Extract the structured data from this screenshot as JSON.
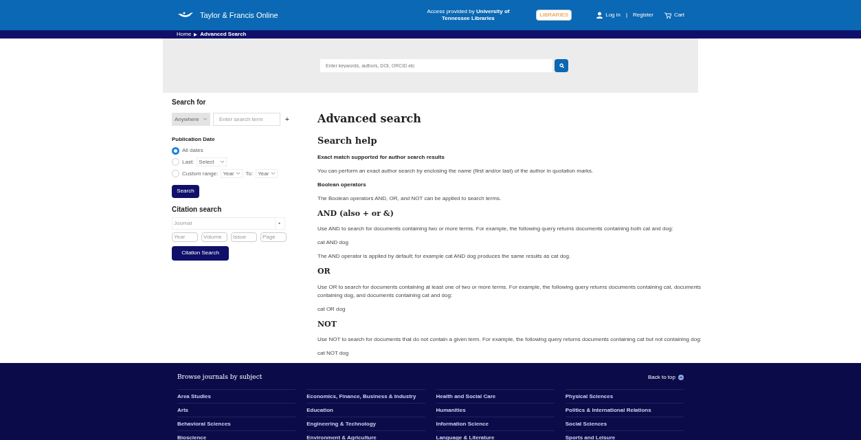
{
  "header": {
    "brand": "Taylor & Francis Online",
    "access": "Access provided by **University of Tennessee Libraries**",
    "library_badge": "LIBRARIES",
    "login": "Log in",
    "separator": "|",
    "register": "Register",
    "cart": "Cart"
  },
  "breadcrumb": [
    {
      "label": "Home"
    },
    {
      "label": "Advanced Search"
    }
  ],
  "quick_search": {
    "placeholder": "Enter keywords, authors, DOI, ORCID etc"
  },
  "search_for": {
    "title": "Search for",
    "scope": "Anywhere",
    "placeholder": "Enter search term",
    "add": "+"
  },
  "publication_date": {
    "title": "Publication Date",
    "options": [
      {
        "kind": "plain",
        "label": "All dates",
        "selected": true
      },
      {
        "kind": "last",
        "label": "Last:",
        "select": "Select",
        "selected": false
      },
      {
        "kind": "range",
        "label": "Custom range:",
        "from": "Year",
        "to_label": "To:",
        "to": "Year",
        "selected": false
      }
    ],
    "button": "Search"
  },
  "citation_search": {
    "title": "Citation search",
    "journal_placeholder": "Journal",
    "fields": [
      {
        "placeholder": "Year"
      },
      {
        "placeholder": "Volume"
      },
      {
        "placeholder": "Issue"
      },
      {
        "placeholder": "Page"
      }
    ],
    "button": "Citation Search"
  },
  "content": {
    "title": "Advanced search",
    "blocks": [
      {
        "kind": "heading",
        "text": "Search help"
      },
      {
        "kind": "label",
        "text": "Exact match supported for author search results"
      },
      {
        "kind": "paragraph",
        "text": "You can perform an exact author search by enclosing the name (first and/or last) of the author in quotation marks."
      },
      {
        "kind": "label",
        "text": "Boolean operators"
      },
      {
        "kind": "paragraph",
        "text": "The Boolean operators AND, OR, and NOT can be applied to search terms."
      },
      {
        "kind": "subheading",
        "text": "AND (also + or &)"
      },
      {
        "kind": "paragraph",
        "text": "Use AND to search for documents containing two or more terms. For example, the following query returns documents containing both cat and dog:"
      },
      {
        "kind": "paragraph",
        "text": "cat AND dog"
      },
      {
        "kind": "paragraph",
        "text": "The AND operator is applied by default; for example cat AND dog produces the same results as cat dog."
      },
      {
        "kind": "subheading",
        "text": "OR"
      },
      {
        "kind": "paragraph",
        "text": "Use OR to search for documents containing at least one of two or more terms. For example, the following query returns documents containing cat, documents containing dog, and documents containing cat and dog:"
      },
      {
        "kind": "paragraph",
        "text": "cat OR dog"
      },
      {
        "kind": "subheading",
        "text": "NOT"
      },
      {
        "kind": "paragraph",
        "text": "Use NOT to search for documents that do not contain a given term. For example, the following query returns documents containing cat but not containing dog:"
      },
      {
        "kind": "paragraph",
        "text": "cat NOT dog"
      }
    ]
  },
  "footer": {
    "title": "Browse journals by subject",
    "back_to_top": "Back to top",
    "columns": [
      [
        "Area Studies",
        "Arts",
        "Behavioral Sciences",
        "Bioscience"
      ],
      [
        "Economics, Finance, Business & Industry",
        "Education",
        "Engineering & Technology",
        "Environment & Agriculture"
      ],
      [
        "Health and Social Care",
        "Humanities",
        "Information Science",
        "Language & Literature"
      ],
      [
        "Physical Sciences",
        "Politics & International Relations",
        "Social Sciences",
        "Sports and Leisure"
      ]
    ]
  }
}
